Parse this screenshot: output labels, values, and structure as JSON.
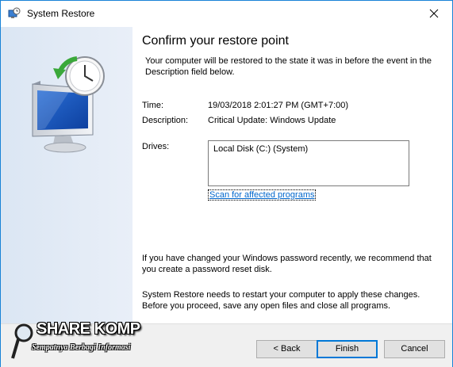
{
  "window": {
    "title": "System Restore",
    "close_icon": "close-icon",
    "app_icon": "system-restore-icon"
  },
  "sidebar": {
    "icon": "monitor-clock-restore-icon"
  },
  "main": {
    "heading": "Confirm your restore point",
    "intro": "Your computer will be restored to the state it was in before the event in the Description field below.",
    "time_label": "Time:",
    "time_value": "19/03/2018 2:01:27 PM (GMT+7:00)",
    "description_label": "Description:",
    "description_value": "Critical Update: Windows Update",
    "drives_label": "Drives:",
    "drives": [
      "Local Disk (C:) (System)"
    ],
    "scan_link": "Scan for affected programs",
    "password_note": "If you have changed your Windows password recently, we recommend that you create a password reset disk.",
    "restart_note": "System Restore needs to restart your computer to apply these changes. Before you proceed, save any open files and close all programs."
  },
  "footer": {
    "back_label": "< Back",
    "finish_label": "Finish",
    "cancel_label": "Cancel"
  },
  "watermark": {
    "title": "SHARE KOMP",
    "subtitle": "Sempatnya Berbagi Informasi"
  },
  "colors": {
    "accent": "#0078d7",
    "link": "#0066cc",
    "sidebar": "#dbe6f3",
    "footer": "#f0f0f0"
  }
}
